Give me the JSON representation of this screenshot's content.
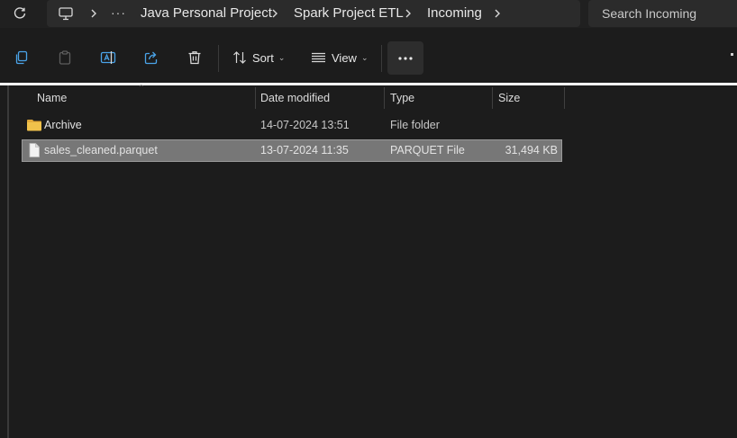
{
  "addressbar": {
    "refresh_icon": "refresh-icon",
    "location_icon": "this-pc-icon",
    "overflow": "···",
    "breadcrumbs": [
      "Java Personal Project",
      "Spark Project ETL",
      "Incoming"
    ],
    "search_placeholder": "Search Incoming"
  },
  "toolbar": {
    "icons": [
      "copy-icon",
      "paste-icon",
      "rename-icon",
      "share-icon",
      "delete-icon"
    ],
    "sort_label": "Sort",
    "view_label": "View",
    "more_label": "···"
  },
  "columns": {
    "name": "Name",
    "date": "Date modified",
    "type": "Type",
    "size": "Size"
  },
  "files": [
    {
      "name": "Archive",
      "date": "14-07-2024 13:51",
      "type": "File folder",
      "size": "",
      "icon": "folder-icon",
      "selected": false
    },
    {
      "name": "sales_cleaned.parquet",
      "date": "13-07-2024 11:35",
      "type": "PARQUET File",
      "size": "31,494 KB",
      "icon": "file-icon",
      "selected": true
    }
  ],
  "colors": {
    "background": "#1c1c1c",
    "bar": "#2b2b2b",
    "selection": "#777777",
    "folder": "#f0c24b"
  }
}
